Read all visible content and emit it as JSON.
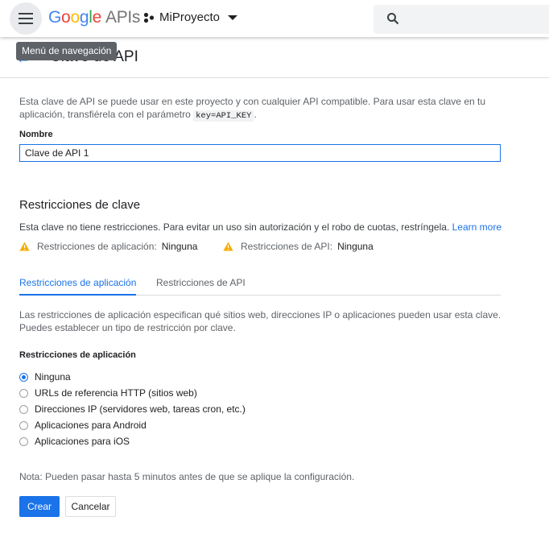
{
  "header": {
    "logo_letters": [
      "G",
      "o",
      "o",
      "g",
      "l",
      "e"
    ],
    "logo_suffix": "APIs",
    "project_name": "MiProyecto",
    "icons": {
      "menu": "hamburger-icon",
      "project": "project-nodes-icon",
      "dropdown": "triangle-down-icon",
      "search": "search-icon"
    }
  },
  "tooltip": "Menú de navegación",
  "page": {
    "title": "Clave de API",
    "back_icon": "arrow-back-icon"
  },
  "description": {
    "part1": "Esta clave de API se puede usar en este proyecto y con cualquier API compatible. Para usar esta clave en tu aplicación, transfiérela con el parámetro",
    "code": "key=API_KEY",
    "part2": "."
  },
  "name_field": {
    "label": "Nombre",
    "value": "Clave de API 1"
  },
  "key_restrictions": {
    "title": "Restricciones de clave",
    "text": "Esta clave no tiene restricciones. Para evitar un uso sin autorización y el robo de cuotas, restríngela.",
    "learn_more": "Learn more",
    "app_warning_label": "Restricciones de aplicación:",
    "app_warning_value": "Ninguna",
    "api_warning_label": "Restricciones de API:",
    "api_warning_value": "Ninguna",
    "warning_icon": "warning-icon"
  },
  "tabs": [
    {
      "label": "Restricciones de aplicación",
      "active": true
    },
    {
      "label": "Restricciones de API",
      "active": false
    }
  ],
  "app_restrictions": {
    "info": "Las restricciones de aplicación especifican qué sitios web, direcciones IP o aplicaciones pueden usar esta clave. Puedes establecer un tipo de restricción por clave.",
    "label": "Restricciones de aplicación",
    "options": [
      {
        "label": "Ninguna",
        "checked": true
      },
      {
        "label": "URLs de referencia HTTP (sitios web)",
        "checked": false
      },
      {
        "label": "Direcciones IP (servidores web, tareas cron, etc.)",
        "checked": false
      },
      {
        "label": "Aplicaciones para Android",
        "checked": false
      },
      {
        "label": "Aplicaciones para iOS",
        "checked": false
      }
    ]
  },
  "note": "Nota: Pueden pasar hasta 5 minutos antes de que se aplique la configuración.",
  "buttons": {
    "create": "Crear",
    "cancel": "Cancelar"
  },
  "colors": {
    "accent": "#1a73e8",
    "warning": "#f9ab00",
    "text": "#202124",
    "secondary_text": "#5f6368"
  }
}
